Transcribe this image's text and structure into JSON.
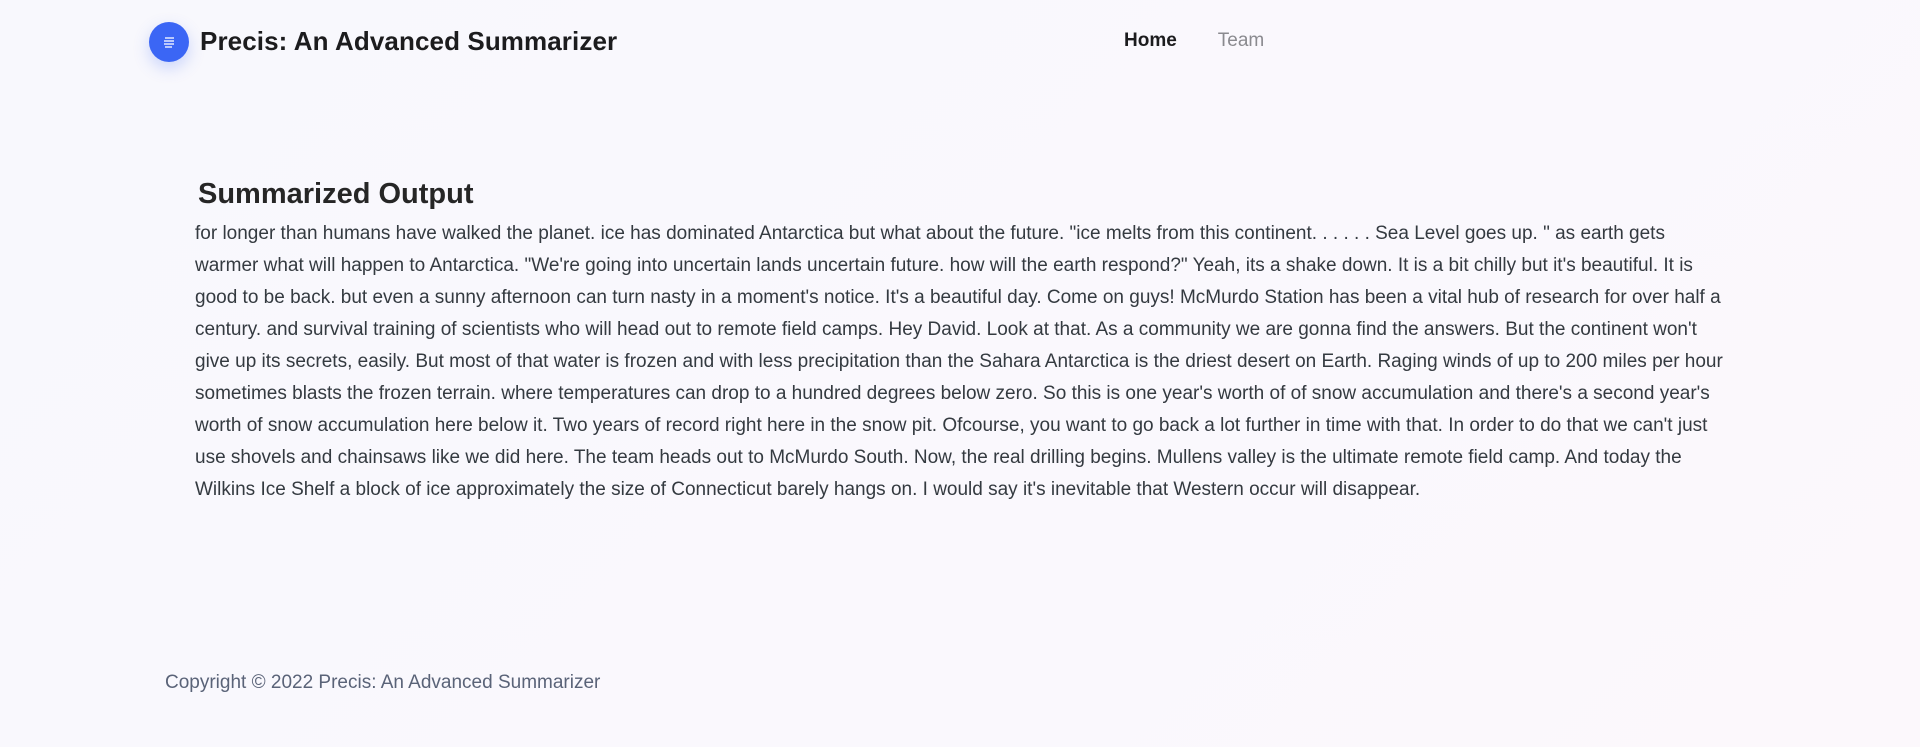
{
  "header": {
    "logo_icon": "text-lines-icon",
    "brand_color": "#3b66f5",
    "title": "Precis: An Advanced Summarizer",
    "nav": [
      {
        "label": "Home",
        "active": true
      },
      {
        "label": "Team",
        "active": false
      }
    ]
  },
  "main": {
    "heading": "Summarized Output",
    "summary": "for longer than humans have walked the planet. ice has dominated Antarctica but what about the future. \"ice melts from this continent. . . . . . Sea Level goes up. \" as earth gets warmer what will happen to Antarctica. \"We're going into uncertain lands uncertain future. how will the earth respond?\" Yeah, its a shake down. It is a bit chilly but it's beautiful. It is good to be back. but even a sunny afternoon can turn nasty in a moment's notice. It's a beautiful day. Come on guys! McMurdo Station has been a vital hub of research for over half a century. and survival training of scientists who will head out to remote field camps. Hey David. Look at that. As a community we are gonna find the answers. But the continent won't give up its secrets, easily. But most of that water is frozen and with less precipitation than the Sahara Antarctica is the driest desert on Earth. Raging winds of up to 200 miles per hour sometimes blasts the frozen terrain. where temperatures can drop to a hundred degrees below zero. So this is one year's worth of of snow accumulation and there's a second year's worth of snow accumulation here below it. Two years of record right here in the snow pit. Ofcourse, you want to go back a lot further in time with that. In order to do that we can't just use shovels and chainsaws like we did here. The team heads out to McMurdo South. Now, the real drilling begins. Mullens valley is the ultimate remote field camp. And today the Wilkins Ice Shelf a block of ice approximately the size of Connecticut barely hangs on. I would say it's inevitable that Western occur will disappear."
  },
  "footer": {
    "copyright": "Copyright © 2022 Precis: An Advanced Summarizer"
  }
}
